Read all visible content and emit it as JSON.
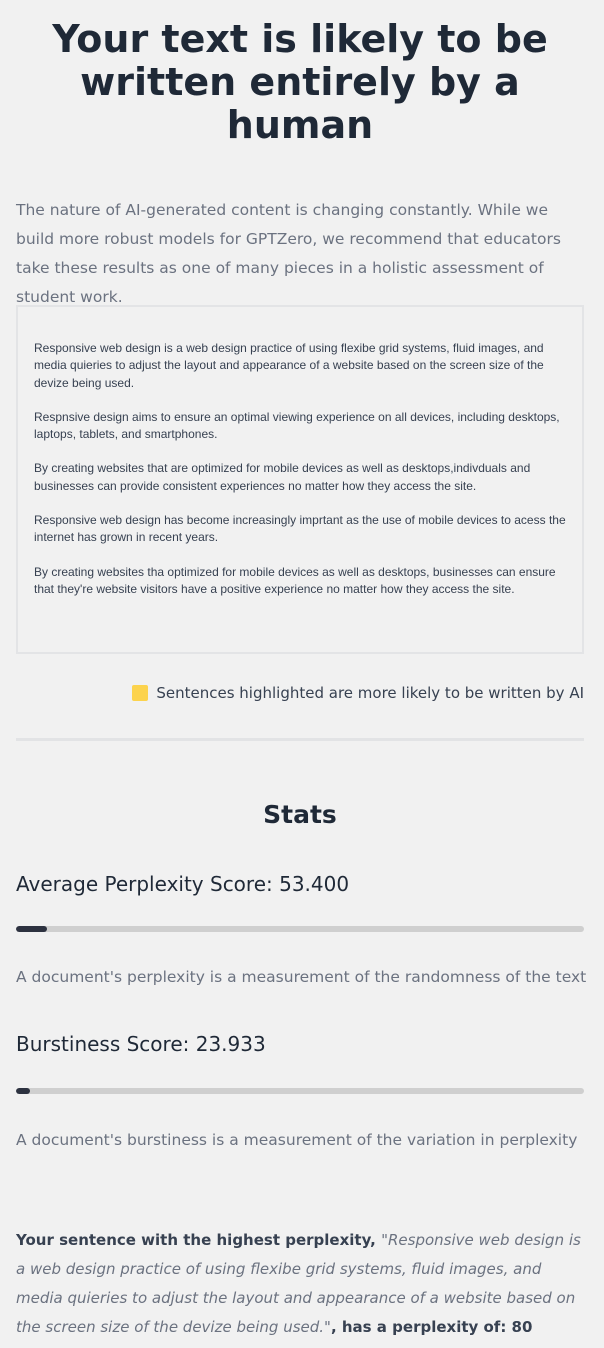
{
  "header": {
    "title": "Your text is likely to be written entirely by a human"
  },
  "intro": {
    "text": "The nature of AI-generated content is changing constantly. While we build more robust models for GPTZero, we recommend that educators take these results as one of many pieces in a holistic assessment of student work."
  },
  "document": {
    "paragraphs": [
      "Responsive web design is a web design practice of using flexibe grid systems, fluid images, and media quieries to adjust the layout and appearance of a website based on the screen size of the devize being used.",
      "Respnsive design aims to ensure an optimal viewing experience on all devices, including desktops, laptops, tablets, and smartphones.",
      "By creating websites that are optimized for mobile devices as well as desktops,indivduals and businesses can provide consistent experiences no matter how they access the site.",
      "Responsive web design has become increasingly imprtant as the use of mobile devices to acess the internet has grown in recent years.",
      "By creating websites tha optimized for mobile devices as well as desktops, businesses can ensure that they're website visitors have a positive experience no matter how they access the site."
    ]
  },
  "legend": {
    "label": "Sentences highlighted are more likely to be written by AI",
    "color": "#fcd34d"
  },
  "stats": {
    "title": "Stats",
    "perplexity": {
      "label": "Average Perplexity Score: 53.400",
      "fill_fraction": 0.055,
      "description": "A document's perplexity is a measurement of the randomness of the text"
    },
    "burstiness": {
      "label": "Burstiness Score: 23.933",
      "fill_fraction": 0.025,
      "description": "A document's burstiness is a measurement of the variation in perplexity"
    }
  },
  "highest": {
    "prefix": "Your sentence with the highest perplexity, ",
    "quote": "\"Responsive web design is a web design practice of using flexibe grid systems, fluid images, and media quieries to adjust the layout and appearance of a website based on the screen size of the devize being used.\"",
    "suffix": ", has a perplexity of: 80"
  },
  "colors": {
    "background": "#f1f1f1",
    "title": "#1f2937",
    "muted_text": "#6b7280",
    "bar_fill": "#2d3240",
    "bar_track": "#cfcfcf"
  }
}
